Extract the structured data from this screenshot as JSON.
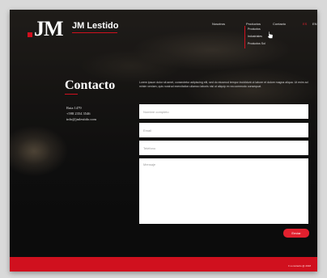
{
  "brand": {
    "logo_text": "JM",
    "name": "JM Lestido"
  },
  "nav": {
    "items": [
      "Nosotros",
      "Productos",
      "Contacto"
    ],
    "languages": [
      "ES",
      "EN"
    ],
    "dropdown": [
      "Productos",
      "Industriales",
      "Productos Sol"
    ]
  },
  "page": {
    "title": "Contacto",
    "intro": "Lorem ipsum dolor sit amet, consectetur adipiscing elit, sed do eiusmod tempor incididunt ut labore et dolore magna aliqua. Ut enim ad minim veniam, quis nostrud exercitation ullamco laboris nisi ut aliquip ex ea commodo consequat."
  },
  "contact_info": {
    "address": "Ruta 1479",
    "phone": "+598 2354 3546",
    "email": "info@jmlestido.com"
  },
  "form": {
    "name_placeholder": "Nombre completo",
    "email_placeholder": "Email",
    "phone_placeholder": "Teléfono",
    "message_placeholder": "Mensaje",
    "submit_label": "Enviar"
  },
  "footer": {
    "text": "Ir a contacto @ 2018"
  },
  "colors": {
    "accent": "#d0101e",
    "background": "#141414"
  }
}
